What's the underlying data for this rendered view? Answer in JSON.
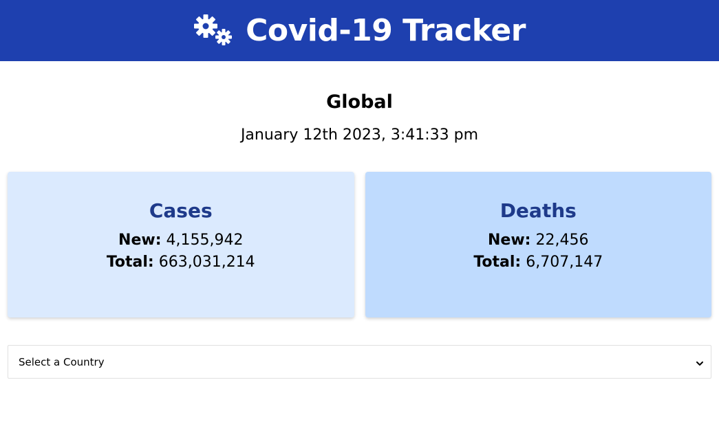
{
  "header": {
    "title": "Covid-19 Tracker",
    "logo_icon": "virus-gears-icon",
    "background_color": "#1e40af"
  },
  "region": {
    "title": "Global",
    "timestamp": "January 12th 2023, 3:41:33 pm"
  },
  "cards": {
    "cases": {
      "title": "Cases",
      "new_label": "New:",
      "new_value": "4,155,942",
      "total_label": "Total:",
      "total_value": "663,031,214",
      "background_color": "#dbeafe"
    },
    "deaths": {
      "title": "Deaths",
      "new_label": "New:",
      "new_value": "22,456",
      "total_label": "Total:",
      "total_value": "6,707,147",
      "background_color": "#bfdbfe"
    }
  },
  "country_select": {
    "selected": "Select a Country",
    "icon": "chevron-down-icon"
  }
}
